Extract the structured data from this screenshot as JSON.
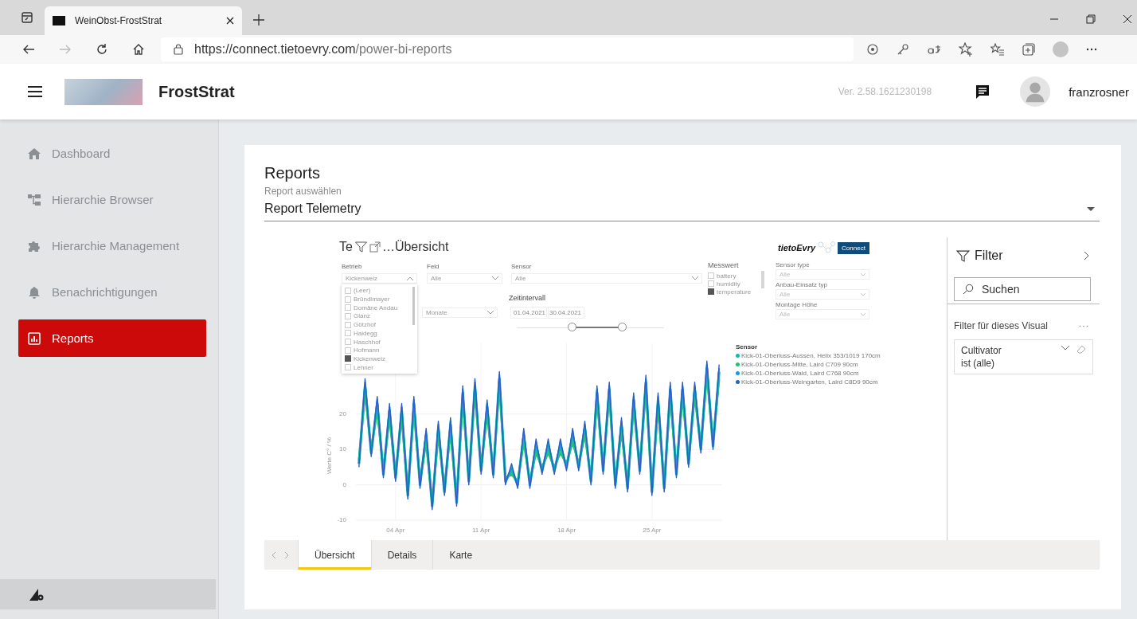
{
  "browser": {
    "tab_title": "WeinObst-FrostStrat",
    "url_host": "https://connect.tietoevry.com",
    "url_path": "/power-bi-reports"
  },
  "header": {
    "app_name": "FrostStrat",
    "version": "Ver. 2.58.1621230198",
    "user": "franzrosner"
  },
  "sidebar": {
    "items": [
      {
        "label": "Dashboard",
        "selected": false
      },
      {
        "label": "Hierarchie Browser",
        "selected": false
      },
      {
        "label": "Hierarchie Management",
        "selected": false
      },
      {
        "label": "Benachrichtigungen",
        "selected": false
      },
      {
        "label": "Reports",
        "selected": true
      }
    ]
  },
  "reports": {
    "title": "Reports",
    "select_label": "Report auswählen",
    "selected_report": "Report Telemetry"
  },
  "visual": {
    "title_start": "Te",
    "title_end": "…Übersicht",
    "betrieb": {
      "label": "Betrieb",
      "value": "Kickenweiz",
      "options": [
        {
          "label": "(Leer)",
          "checked": false
        },
        {
          "label": "Bründlmayer",
          "checked": false
        },
        {
          "label": "Domäne Andau",
          "checked": false
        },
        {
          "label": "Glanz",
          "checked": false
        },
        {
          "label": "Götzhof",
          "checked": false
        },
        {
          "label": "Haidegg",
          "checked": false
        },
        {
          "label": "Haschhof",
          "checked": false
        },
        {
          "label": "Hofmann",
          "checked": false
        },
        {
          "label": "Kickenweiz",
          "checked": true
        },
        {
          "label": "Lehner",
          "checked": false
        }
      ]
    },
    "feld": {
      "label": "Feld",
      "value": "Alle"
    },
    "sensor": {
      "label": "Sensor",
      "value": "Alle"
    },
    "period": {
      "value": "Monate"
    },
    "zeitintervall": {
      "label": "Zeitintervall",
      "from": "01.04.2021",
      "to": "30.04.2021",
      "thumbs": [
        {
          "level": 0.38
        },
        {
          "level": 0.72
        }
      ]
    },
    "messwert": {
      "label": "Messwert",
      "options": [
        {
          "label": "battery",
          "checked": false
        },
        {
          "label": "humidity",
          "checked": false
        },
        {
          "label": "temperature",
          "checked": true
        }
      ]
    },
    "small_filters": [
      {
        "label": "Sensor type",
        "value": "Alle"
      },
      {
        "label": "Anbau-Einsatz typ",
        "value": "Alle"
      },
      {
        "label": "Montage Höhe",
        "value": "Alle"
      }
    ],
    "logo": {
      "brand": "tietoEvry",
      "badge": "Connect"
    },
    "legend_title": "Sensor",
    "chart_data": {
      "type": "line",
      "ylabel": "Werte C° / %",
      "ylim": [
        -10,
        40
      ],
      "grid": true,
      "categories": [
        null,
        null,
        null,
        null,
        null,
        null,
        "04 Apr",
        null,
        null,
        null,
        null,
        null,
        null,
        null,
        null,
        null,
        null,
        null,
        null,
        null,
        "11 Apr",
        null,
        null,
        null,
        null,
        null,
        null,
        null,
        null,
        null,
        null,
        null,
        null,
        null,
        "18 Apr",
        null,
        null,
        null,
        null,
        null,
        null,
        null,
        null,
        null,
        null,
        null,
        null,
        null,
        "25 Apr",
        null,
        null,
        null,
        null,
        null,
        null,
        null,
        null,
        null,
        null,
        null
      ],
      "yticks": [
        -10,
        0,
        10,
        20
      ],
      "series": [
        {
          "name": "Kick-01-Oberluss-Aussen, Helix 353/1019 170cm",
          "color": "#17b8a6",
          "values": [
            6,
            28,
            9,
            23,
            3,
            21,
            2,
            21,
            -3,
            23,
            0,
            14,
            -6,
            16,
            -2,
            17,
            -5,
            26,
            1,
            28,
            4,
            22,
            3,
            30,
            1,
            4,
            0,
            14,
            0,
            11,
            4,
            11,
            4,
            11,
            5,
            14,
            5,
            16,
            1,
            26,
            4,
            27,
            0,
            17,
            -1,
            24,
            4,
            29,
            -2,
            24,
            -1,
            27,
            3,
            27,
            6,
            27,
            10,
            33,
            11,
            32
          ]
        },
        {
          "name": "Kick-01-Oberluss-Mitte, Laird C709 90cm",
          "color": "#22c46e",
          "values": [
            7,
            26,
            10,
            21,
            4,
            19,
            3,
            19,
            -2,
            21,
            1,
            12,
            -5,
            14,
            -1,
            15,
            -4,
            24,
            2,
            26,
            5,
            20,
            4,
            28,
            2,
            3,
            1,
            12,
            1,
            9,
            5,
            9,
            5,
            9,
            6,
            12,
            6,
            14,
            2,
            24,
            5,
            25,
            1,
            15,
            0,
            22,
            5,
            27,
            -1,
            22,
            0,
            25,
            4,
            25,
            7,
            25,
            11,
            31,
            12,
            30
          ]
        },
        {
          "name": "Kick-01-Oberluss-Wald, Laird C768 90cm",
          "color": "#1b97dc",
          "values": [
            6,
            29,
            9,
            24,
            3,
            22,
            2,
            22,
            -3,
            24,
            0,
            15,
            -6,
            17,
            -2,
            18,
            -5,
            27,
            1,
            29,
            4,
            23,
            3,
            31,
            1,
            5,
            0,
            15,
            0,
            12,
            4,
            12,
            4,
            12,
            5,
            15,
            5,
            17,
            1,
            27,
            4,
            28,
            0,
            18,
            -1,
            25,
            4,
            30,
            -2,
            25,
            -1,
            28,
            3,
            28,
            6,
            28,
            10,
            34,
            11,
            33
          ]
        },
        {
          "name": "Kick-01-Oberluss-Weingarten, Laird C8D9 90cm",
          "color": "#2c5fc6",
          "values": [
            5,
            30,
            8,
            25,
            2,
            23,
            1,
            23,
            -4,
            25,
            -1,
            16,
            -7,
            18,
            -3,
            19,
            -6,
            28,
            0,
            30,
            3,
            24,
            2,
            32,
            0,
            6,
            -1,
            16,
            -1,
            13,
            3,
            13,
            3,
            13,
            4,
            16,
            4,
            18,
            0,
            28,
            3,
            29,
            -1,
            19,
            -2,
            26,
            3,
            31,
            -3,
            26,
            -2,
            29,
            2,
            29,
            5,
            29,
            9,
            35,
            10,
            34
          ]
        }
      ]
    }
  },
  "filter_pane": {
    "title": "Filter",
    "search_placeholder": "Suchen",
    "section": "Filter für dieses Visual",
    "card": {
      "field": "Cultivator",
      "condition": "ist (alle)"
    }
  },
  "page_tabs": [
    {
      "label": "Übersicht",
      "selected": true
    },
    {
      "label": "Details",
      "selected": false
    },
    {
      "label": "Karte",
      "selected": false
    }
  ]
}
